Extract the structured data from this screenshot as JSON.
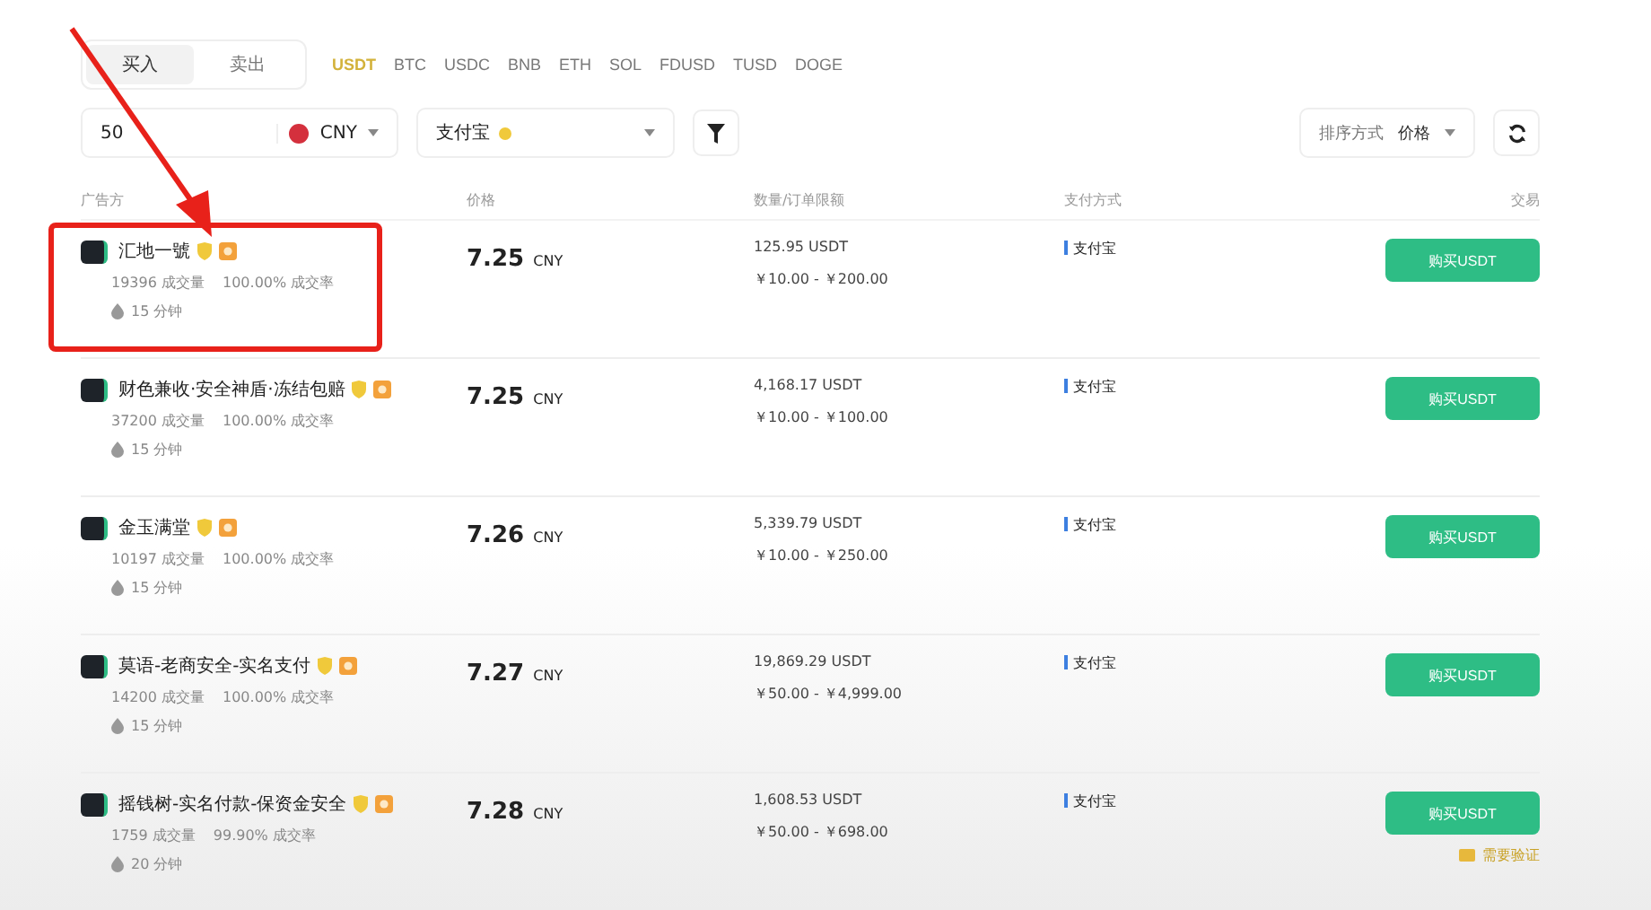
{
  "trade_tabs": [
    {
      "label": "买入",
      "selected": true
    },
    {
      "label": "卖出",
      "selected": false
    }
  ],
  "coins": [
    {
      "label": "USDT",
      "selected": true
    },
    {
      "label": "BTC",
      "selected": false
    },
    {
      "label": "USDC",
      "selected": false
    },
    {
      "label": "BNB",
      "selected": false
    },
    {
      "label": "ETH",
      "selected": false
    },
    {
      "label": "SOL",
      "selected": false
    },
    {
      "label": "FDUSD",
      "selected": false
    },
    {
      "label": "TUSD",
      "selected": false
    },
    {
      "label": "DOGE",
      "selected": false
    }
  ],
  "amount_field": {
    "value": "50",
    "currency": "CNY"
  },
  "payment_filter": {
    "value": "支付宝"
  },
  "sort": {
    "label": "排序方式",
    "value": "价格"
  },
  "table": {
    "columns": [
      "广告方",
      "价格",
      "数量/订单限额",
      "支付方式",
      "交易"
    ],
    "rows": [
      {
        "advertiser": "汇地一號",
        "trades": "19396 成交量",
        "rate": "100.00% 成交率",
        "time": "15 分钟",
        "price": "7.25",
        "currency": "CNY",
        "available": "125.95 USDT",
        "limit": "￥10.00 - ￥200.00",
        "payment": "支付宝",
        "action": "购买USDT",
        "highlighted": true
      },
      {
        "advertiser": "财色兼收·安全神盾·冻结包赔",
        "trades": "37200 成交量",
        "rate": "100.00% 成交率",
        "time": "15 分钟",
        "price": "7.25",
        "currency": "CNY",
        "available": "4,168.17 USDT",
        "limit": "￥10.00 - ￥100.00",
        "payment": "支付宝",
        "action": "购买USDT",
        "highlighted": false
      },
      {
        "advertiser": "金玉满堂",
        "trades": "10197 成交量",
        "rate": "100.00% 成交率",
        "time": "15 分钟",
        "price": "7.26",
        "currency": "CNY",
        "available": "5,339.79 USDT",
        "limit": "￥10.00 - ￥250.00",
        "payment": "支付宝",
        "action": "购买USDT",
        "highlighted": false
      },
      {
        "advertiser": "莫语-老商安全-实名支付",
        "trades": "14200 成交量",
        "rate": "100.00% 成交率",
        "time": "15 分钟",
        "price": "7.27",
        "currency": "CNY",
        "available": "19,869.29 USDT",
        "limit": "￥50.00 - ￥4,999.00",
        "payment": "支付宝",
        "action": "购买USDT",
        "highlighted": false
      },
      {
        "advertiser": "摇钱树-实名付款-保资金安全",
        "trades": "1759 成交量",
        "rate": "99.90% 成交率",
        "time": "20 分钟",
        "price": "7.28",
        "currency": "CNY",
        "available": "1,608.53 USDT",
        "limit": "￥50.00 - ￥698.00",
        "payment": "支付宝",
        "action": "购买USDT",
        "highlighted": false,
        "note": "需要验证"
      }
    ]
  }
}
